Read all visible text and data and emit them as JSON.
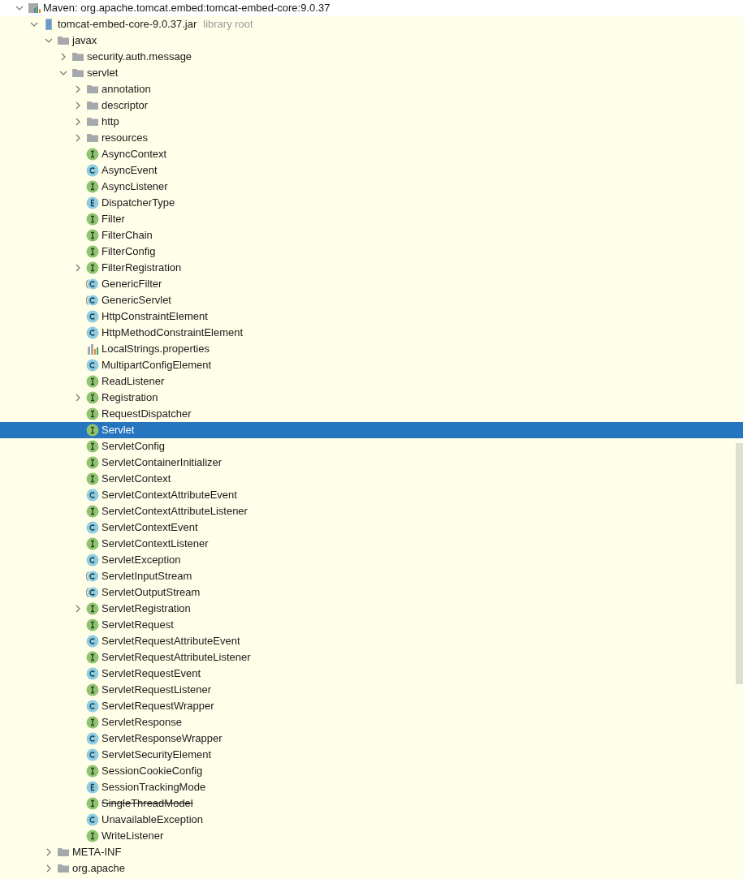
{
  "tree": [
    {
      "kind": "maven",
      "label": "Maven: org.apache.tomcat.embed:tomcat-embed-core:9.0.37",
      "expanded": true,
      "selected": false,
      "children": [
        {
          "kind": "jar",
          "label": "tomcat-embed-core-9.0.37.jar",
          "hint": "library root",
          "expanded": true,
          "selected": false,
          "children": [
            {
              "kind": "folder",
              "label": "javax",
              "expanded": true,
              "selected": false,
              "children": [
                {
                  "kind": "folder",
                  "label": "security.auth.message",
                  "expanded": false,
                  "selected": false
                },
                {
                  "kind": "folder",
                  "label": "servlet",
                  "expanded": true,
                  "selected": false,
                  "children": [
                    {
                      "kind": "folder",
                      "label": "annotation",
                      "expanded": false,
                      "selected": false,
                      "deprecated": false
                    },
                    {
                      "kind": "folder",
                      "label": "descriptor",
                      "expanded": false,
                      "selected": false,
                      "deprecated": false
                    },
                    {
                      "kind": "folder",
                      "label": "http",
                      "expanded": false,
                      "selected": false,
                      "deprecated": false
                    },
                    {
                      "kind": "folder",
                      "label": "resources",
                      "expanded": false,
                      "selected": false,
                      "deprecated": false
                    },
                    {
                      "kind": "interface",
                      "label": "AsyncContext",
                      "selected": false,
                      "deprecated": false
                    },
                    {
                      "kind": "class",
                      "label": "AsyncEvent",
                      "selected": false,
                      "deprecated": false
                    },
                    {
                      "kind": "interface",
                      "label": "AsyncListener",
                      "selected": false,
                      "deprecated": false
                    },
                    {
                      "kind": "enum",
                      "label": "DispatcherType",
                      "selected": false,
                      "deprecated": false
                    },
                    {
                      "kind": "interface",
                      "label": "Filter",
                      "selected": false,
                      "deprecated": false
                    },
                    {
                      "kind": "interface",
                      "label": "FilterChain",
                      "selected": false,
                      "deprecated": false
                    },
                    {
                      "kind": "interface",
                      "label": "FilterConfig",
                      "selected": false,
                      "deprecated": false
                    },
                    {
                      "kind": "interface",
                      "label": "FilterRegistration",
                      "expanded": false,
                      "selected": false,
                      "deprecated": false
                    },
                    {
                      "kind": "abstract",
                      "label": "GenericFilter",
                      "selected": false,
                      "deprecated": false
                    },
                    {
                      "kind": "abstract",
                      "label": "GenericServlet",
                      "selected": false,
                      "deprecated": false
                    },
                    {
                      "kind": "class",
                      "label": "HttpConstraintElement",
                      "selected": false,
                      "deprecated": false
                    },
                    {
                      "kind": "class",
                      "label": "HttpMethodConstraintElement",
                      "selected": false,
                      "deprecated": false
                    },
                    {
                      "kind": "properties",
                      "label": "LocalStrings.properties",
                      "selected": false,
                      "deprecated": false
                    },
                    {
                      "kind": "class",
                      "label": "MultipartConfigElement",
                      "selected": false,
                      "deprecated": false
                    },
                    {
                      "kind": "interface",
                      "label": "ReadListener",
                      "selected": false,
                      "deprecated": false
                    },
                    {
                      "kind": "interface",
                      "label": "Registration",
                      "expanded": false,
                      "selected": false,
                      "deprecated": false
                    },
                    {
                      "kind": "interface",
                      "label": "RequestDispatcher",
                      "selected": false,
                      "deprecated": false
                    },
                    {
                      "kind": "interface",
                      "label": "Servlet",
                      "selected": true,
                      "deprecated": false
                    },
                    {
                      "kind": "interface",
                      "label": "ServletConfig",
                      "selected": false,
                      "deprecated": false
                    },
                    {
                      "kind": "interface",
                      "label": "ServletContainerInitializer",
                      "selected": false,
                      "deprecated": false
                    },
                    {
                      "kind": "interface",
                      "label": "ServletContext",
                      "selected": false,
                      "deprecated": false
                    },
                    {
                      "kind": "class",
                      "label": "ServletContextAttributeEvent",
                      "selected": false,
                      "deprecated": false
                    },
                    {
                      "kind": "interface",
                      "label": "ServletContextAttributeListener",
                      "selected": false,
                      "deprecated": false
                    },
                    {
                      "kind": "class",
                      "label": "ServletContextEvent",
                      "selected": false,
                      "deprecated": false
                    },
                    {
                      "kind": "interface",
                      "label": "ServletContextListener",
                      "selected": false,
                      "deprecated": false
                    },
                    {
                      "kind": "class",
                      "label": "ServletException",
                      "selected": false,
                      "deprecated": false
                    },
                    {
                      "kind": "abstract",
                      "label": "ServletInputStream",
                      "selected": false,
                      "deprecated": false
                    },
                    {
                      "kind": "abstract",
                      "label": "ServletOutputStream",
                      "selected": false,
                      "deprecated": false
                    },
                    {
                      "kind": "interface",
                      "label": "ServletRegistration",
                      "expanded": false,
                      "selected": false,
                      "deprecated": false
                    },
                    {
                      "kind": "interface",
                      "label": "ServletRequest",
                      "selected": false,
                      "deprecated": false
                    },
                    {
                      "kind": "class",
                      "label": "ServletRequestAttributeEvent",
                      "selected": false,
                      "deprecated": false
                    },
                    {
                      "kind": "interface",
                      "label": "ServletRequestAttributeListener",
                      "selected": false,
                      "deprecated": false
                    },
                    {
                      "kind": "class",
                      "label": "ServletRequestEvent",
                      "selected": false,
                      "deprecated": false
                    },
                    {
                      "kind": "interface",
                      "label": "ServletRequestListener",
                      "selected": false,
                      "deprecated": false
                    },
                    {
                      "kind": "class",
                      "label": "ServletRequestWrapper",
                      "selected": false,
                      "deprecated": false
                    },
                    {
                      "kind": "interface",
                      "label": "ServletResponse",
                      "selected": false,
                      "deprecated": false
                    },
                    {
                      "kind": "class",
                      "label": "ServletResponseWrapper",
                      "selected": false,
                      "deprecated": false
                    },
                    {
                      "kind": "class",
                      "label": "ServletSecurityElement",
                      "selected": false,
                      "deprecated": false
                    },
                    {
                      "kind": "interface",
                      "label": "SessionCookieConfig",
                      "selected": false,
                      "deprecated": false
                    },
                    {
                      "kind": "enum",
                      "label": "SessionTrackingMode",
                      "selected": false,
                      "deprecated": false
                    },
                    {
                      "kind": "interface",
                      "label": "SingleThreadModel",
                      "selected": false,
                      "deprecated": true
                    },
                    {
                      "kind": "class",
                      "label": "UnavailableException",
                      "selected": false,
                      "deprecated": false
                    },
                    {
                      "kind": "interface",
                      "label": "WriteListener",
                      "selected": false,
                      "deprecated": false
                    }
                  ]
                }
              ]
            },
            {
              "kind": "folder",
              "label": "META-INF",
              "expanded": false,
              "selected": false
            },
            {
              "kind": "folder",
              "label": "org.apache",
              "expanded": false,
              "selected": false
            }
          ]
        }
      ]
    }
  ]
}
